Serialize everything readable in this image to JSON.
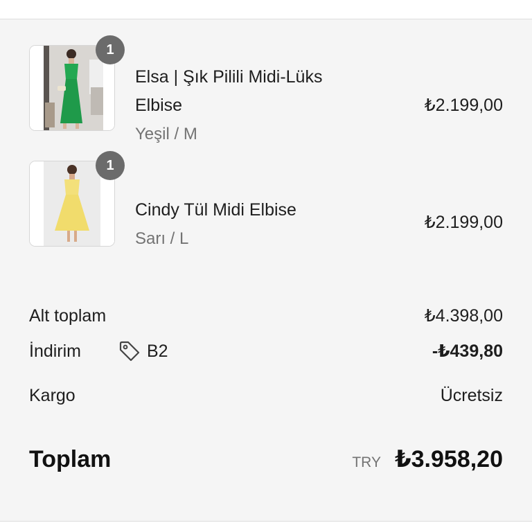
{
  "cart": {
    "items": [
      {
        "name": "Elsa | Şık Pilili Midi-Lüks Elbise",
        "variant": "Yeşil / M",
        "price": "₺2.199,00",
        "quantity": "1",
        "image_icon": "green-dress-image"
      },
      {
        "name": "Cindy Tül Midi Elbise",
        "variant": "Sarı / L",
        "price": "₺2.199,00",
        "quantity": "1",
        "image_icon": "yellow-dress-image"
      }
    ]
  },
  "summary": {
    "subtotal_label": "Alt toplam",
    "subtotal_value": "₺4.398,00",
    "discount_label": "İndirim",
    "discount_code": "B2",
    "discount_icon": "tag-icon",
    "discount_value": "-₺439,80",
    "shipping_label": "Kargo",
    "shipping_value": "Ücretsiz",
    "total_label": "Toplam",
    "currency_code": "TRY",
    "total_value": "₺3.958,20"
  },
  "colors": {
    "panel_background": "#f5f5f5",
    "badge": "#6b6b6b",
    "muted_text": "#737373",
    "green_dress": "#23a852",
    "yellow_dress": "#f3e07a"
  }
}
